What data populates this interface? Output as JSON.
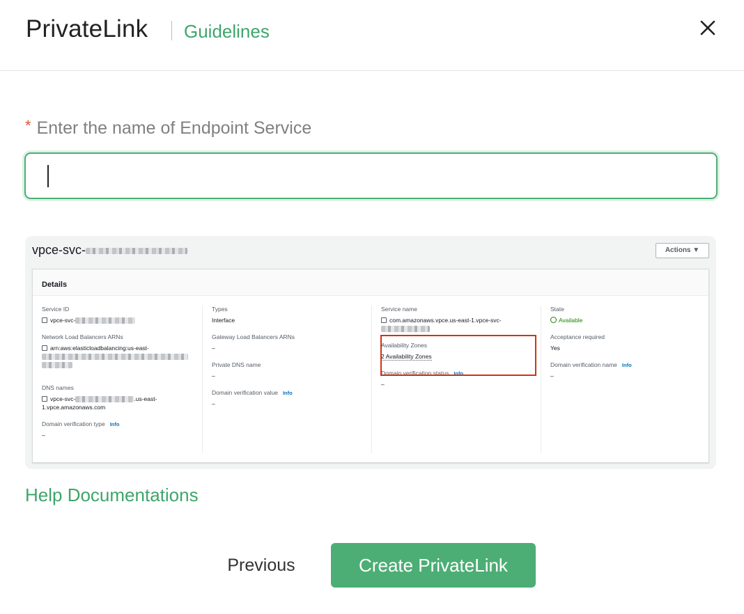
{
  "header": {
    "title": "PrivateLink",
    "guidelines_link": "Guidelines"
  },
  "form": {
    "required_marker": "*",
    "label": "Enter the name of Endpoint Service",
    "input_value": "",
    "input_placeholder": ""
  },
  "example_screenshot": {
    "resource_title_prefix": "vpce-svc-",
    "actions_label": "Actions ▼",
    "details_heading": "Details",
    "info_label": "Info",
    "empty_value": "–",
    "columns": [
      [
        {
          "key": "Service ID",
          "value": "vpce-svc-"
        },
        {
          "key": "Network Load Balancers ARNs",
          "value": "arn:aws:elasticloadbalancing:us-east-"
        },
        {
          "key": "DNS names",
          "value": "vpce-svc-",
          "value_suffix": ".us-east-",
          "value_line2": "1.vpce.amazonaws.com"
        },
        {
          "key": "Domain verification type",
          "value": "–"
        }
      ],
      [
        {
          "key": "Types",
          "value": "Interface"
        },
        {
          "key": "Gateway Load Balancers ARNs",
          "value": "–"
        },
        {
          "key": "Private DNS name",
          "value": "–"
        },
        {
          "key": "Domain verification value",
          "value": "–"
        }
      ],
      [
        {
          "key": "Service name",
          "value": "com.amazonaws.vpce.us-east-1.vpce-svc-"
        },
        {
          "key": "Availability Zones",
          "value": "2 Availability Zones"
        },
        {
          "key": "Domain verification status",
          "value": "–"
        }
      ],
      [
        {
          "key": "State",
          "value": "Available"
        },
        {
          "key": "Acceptance required",
          "value": "Yes"
        },
        {
          "key": "Domain verification name",
          "value": "–"
        }
      ]
    ],
    "highlight_color": "#d13212",
    "status_color": "#1d8102"
  },
  "help_link": "Help Documentations",
  "buttons": {
    "previous": "Previous",
    "create": "Create PrivateLink"
  },
  "colors": {
    "accent": "#4cae74",
    "link": "#3fa56b",
    "required": "#e0533e"
  }
}
